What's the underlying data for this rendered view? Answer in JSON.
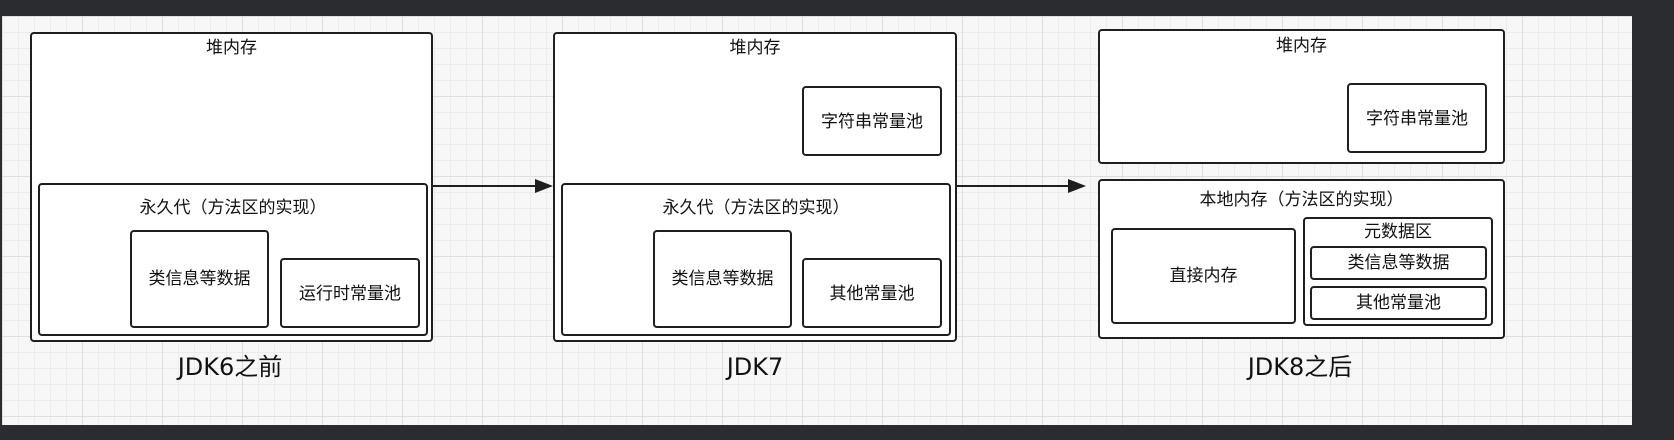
{
  "jdk6": {
    "heap_label": "堆内存",
    "permgen_label": "永久代（方法区的实现）",
    "class_info_label": "类信息等数据",
    "runtime_pool_label": "运行时常量池",
    "caption": "JDK6之前"
  },
  "jdk7": {
    "heap_label": "堆内存",
    "string_pool_label": "字符串常量池",
    "permgen_label": "永久代（方法区的实现）",
    "class_info_label": "类信息等数据",
    "other_pool_label": "其他常量池",
    "caption": "JDK7"
  },
  "jdk8": {
    "heap_label": "堆内存",
    "string_pool_label": "字符串常量池",
    "native_label": "本地内存（方法区的实现）",
    "direct_memory_label": "直接内存",
    "metaspace_label": "元数据区",
    "class_info_label": "类信息等数据",
    "other_pool_label": "其他常量池",
    "caption": "JDK8之后"
  }
}
